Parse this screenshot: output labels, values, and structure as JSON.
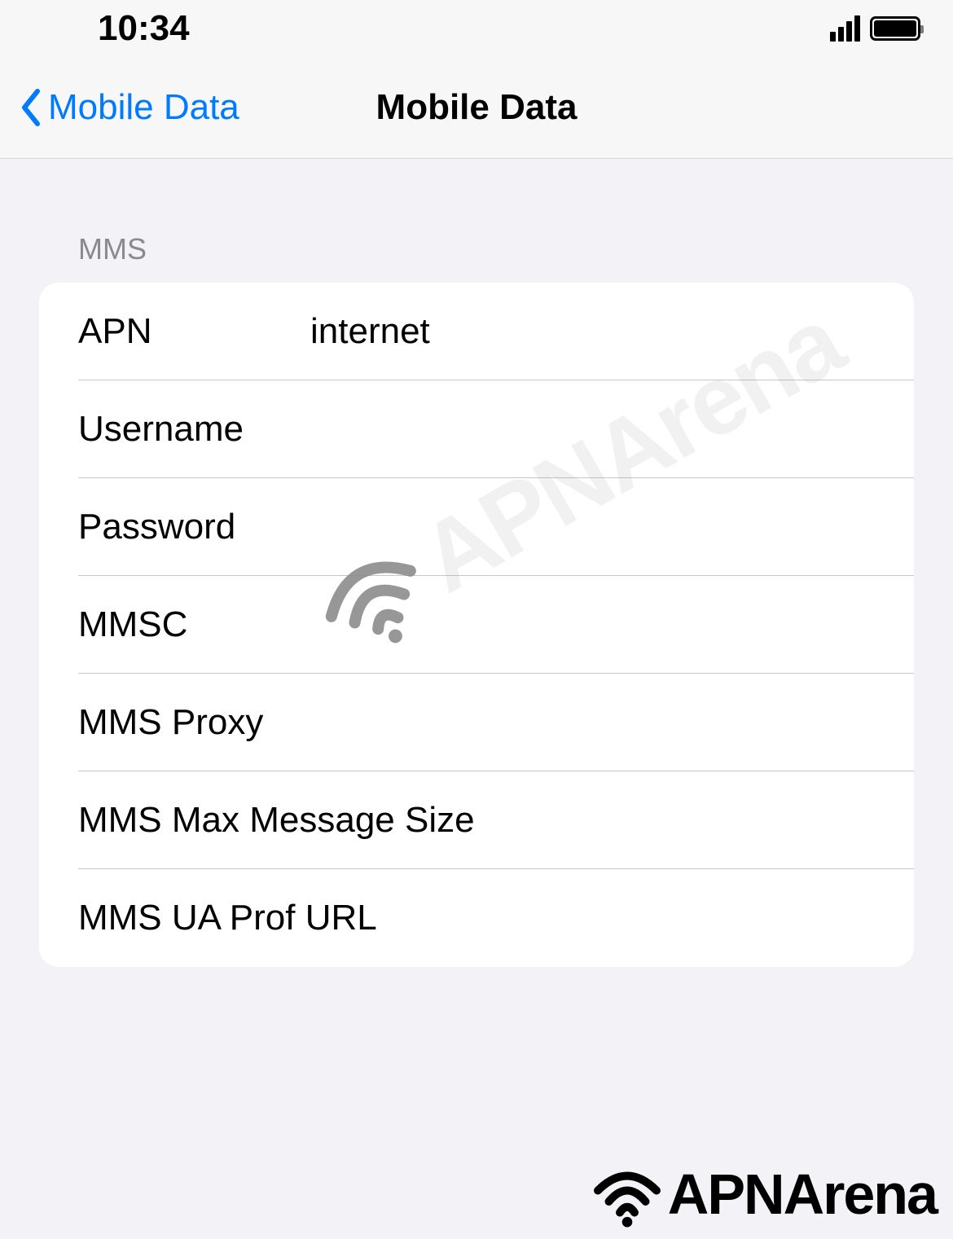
{
  "statusBar": {
    "time": "10:34"
  },
  "navBar": {
    "backLabel": "Mobile Data",
    "title": "Mobile Data"
  },
  "section": {
    "header": "MMS"
  },
  "fields": {
    "apn": {
      "label": "APN",
      "value": "internet"
    },
    "username": {
      "label": "Username",
      "value": ""
    },
    "password": {
      "label": "Password",
      "value": ""
    },
    "mmsc": {
      "label": "MMSC",
      "value": ""
    },
    "mmsProxy": {
      "label": "MMS Proxy",
      "value": ""
    },
    "mmsMaxSize": {
      "label": "MMS Max Message Size",
      "value": ""
    },
    "mmsUaProfUrl": {
      "label": "MMS UA Prof URL",
      "value": ""
    }
  },
  "watermark": {
    "text": "APNArena"
  },
  "footer": {
    "text": "APNArena"
  }
}
